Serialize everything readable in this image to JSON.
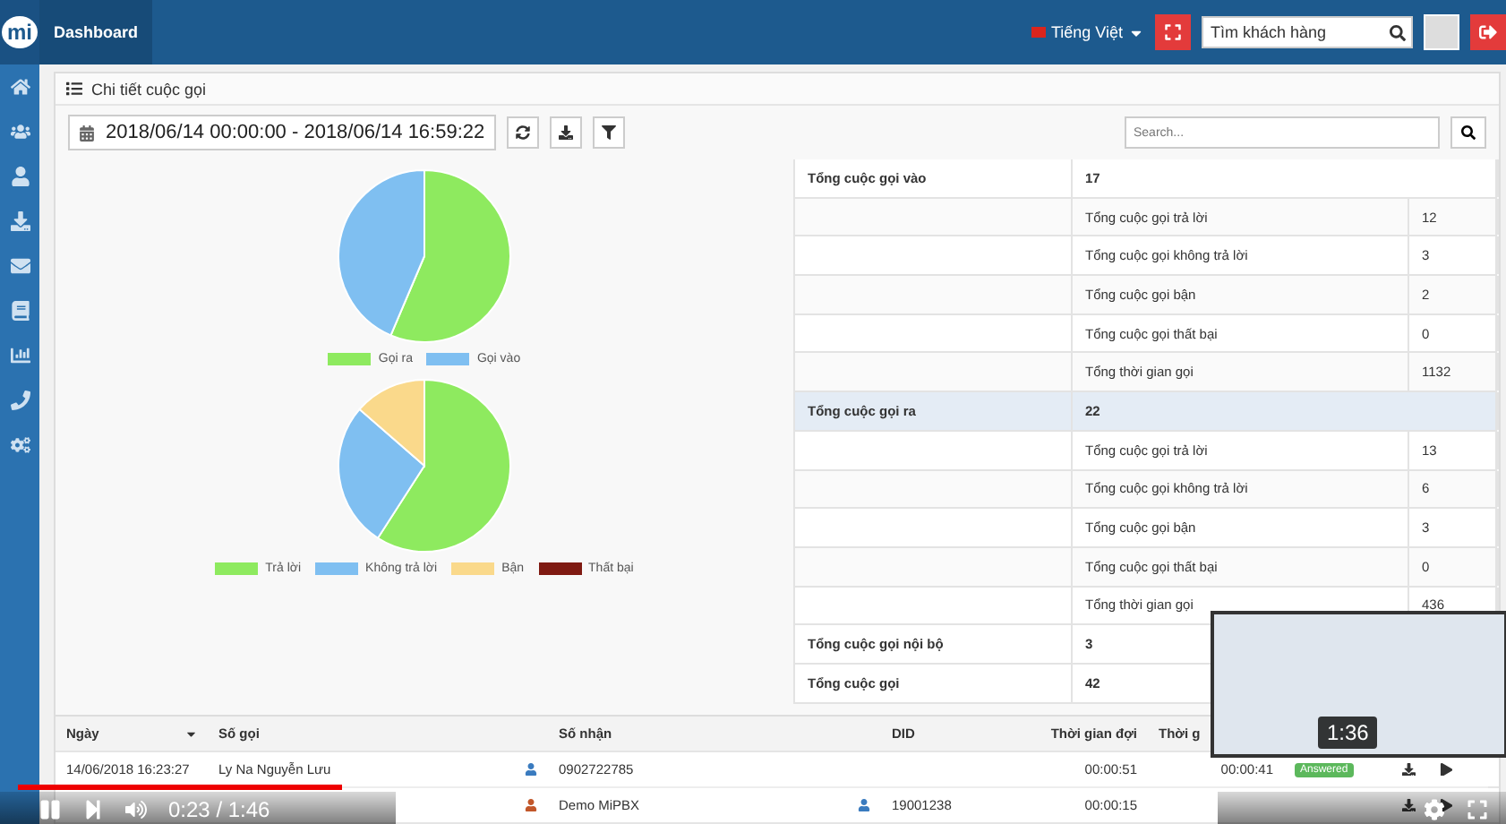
{
  "navbar": {
    "logo": "mi",
    "tab": "Dashboard",
    "language": "Tiếng Việt",
    "search": {
      "placeholder": "Tìm khách hàng"
    }
  },
  "panel": {
    "title": "Chi tiết cuộc gọi",
    "date_range": "2018/06/14 00:00:00 - 2018/06/14 16:59:22",
    "search": {
      "placeholder": "Search..."
    }
  },
  "charts": [
    {
      "chart_data": {
        "type": "pie",
        "categories": [
          "Gọi ra",
          "Gọi vào"
        ],
        "series": [
          {
            "values": [
              56.4,
              43.6
            ]
          }
        ],
        "colors": [
          "#8eea5f",
          "#7fbff1"
        ],
        "legend": true
      }
    },
    {
      "chart_data": {
        "type": "pie",
        "categories": [
          "Trả lời",
          "Không trả lời",
          "Bận",
          "Thất bại"
        ],
        "series": [
          {
            "values": [
              59.1,
              27.3,
              13.6,
              0
            ]
          }
        ],
        "colors": [
          "#8eea5f",
          "#7fbff1",
          "#fad98b",
          "#7f1a12"
        ],
        "legend": true
      }
    }
  ],
  "summary": [
    {
      "label": "Tổng cuộc gọi vào",
      "value": "17",
      "selected": false,
      "children": [
        {
          "label": "Tổng cuộc gọi trả lời",
          "value": "12"
        },
        {
          "label": "Tổng cuộc gọi không trả lời",
          "value": "3"
        },
        {
          "label": "Tổng cuộc gọi bận",
          "value": "2"
        },
        {
          "label": "Tổng cuộc gọi thất bại",
          "value": "0"
        },
        {
          "label": "Tổng thời gian gọi",
          "value": "1132"
        }
      ]
    },
    {
      "label": "Tổng cuộc gọi ra",
      "value": "22",
      "selected": true,
      "children": [
        {
          "label": "Tổng cuộc gọi trả lời",
          "value": "13"
        },
        {
          "label": "Tổng cuộc gọi không trả lời",
          "value": "6"
        },
        {
          "label": "Tổng cuộc gọi bận",
          "value": "3"
        },
        {
          "label": "Tổng cuộc gọi thất bại",
          "value": "0"
        },
        {
          "label": "Tổng thời gian gọi",
          "value": "436"
        }
      ]
    },
    {
      "label": "Tổng cuộc gọi nội bộ",
      "value": "3",
      "selected": false
    },
    {
      "label": "Tổng cuộc gọi",
      "value": "42",
      "selected": false
    }
  ],
  "calls": {
    "columns": [
      "Ngày",
      "Số gọi",
      "Số nhận",
      "DID",
      "Thời gian đợi",
      "Thời g"
    ],
    "rows": [
      {
        "date": "14/06/2018 16:23:27",
        "caller": "Ly Na Nguyễn Lưu",
        "caller_icon": {
          "color": "#3a7bbf"
        },
        "callee": "0902722785",
        "wait": "00:00:51",
        "talk": "00:00:41",
        "status": "Answered"
      },
      {
        "caller_icon": {
          "color": "#c2572a"
        },
        "callee": "Demo MiPBX",
        "callee_icon": {
          "color": "#3a7bbf"
        },
        "did": "19001238",
        "wait": "00:00:15"
      }
    ]
  },
  "player": {
    "time": "0:23 / 1:46",
    "level": 0.22,
    "preview_time": "1:36"
  }
}
